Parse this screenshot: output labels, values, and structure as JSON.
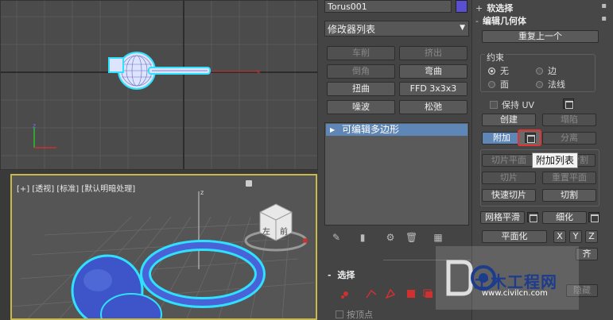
{
  "viewport_top": {
    "axis_x": "x",
    "axis_y": "y"
  },
  "viewport_persp": {
    "labels": [
      "[+]",
      "[透视]",
      "[标准]",
      "[默认明暗处理]"
    ],
    "viewcube_front": "前",
    "viewcube_left": "左",
    "axis_z": "z"
  },
  "command_panel": {
    "object_name": "Torus001",
    "object_color": "#5a4fd0",
    "modifier_list": "修改器列表",
    "modifier_buttons": [
      {
        "label": "车削",
        "enabled": false
      },
      {
        "label": "挤出",
        "enabled": false
      },
      {
        "label": "倒角",
        "enabled": false
      },
      {
        "label": "弯曲",
        "enabled": true
      },
      {
        "label": "扭曲",
        "enabled": true
      },
      {
        "label": "FFD 3x3x3",
        "enabled": true
      },
      {
        "label": "噪波",
        "enabled": true
      },
      {
        "label": "松弛",
        "enabled": true
      }
    ],
    "stack_item": "可编辑多边形",
    "selection_header": "选择",
    "selection_sign": "-",
    "by_vertex": "按顶点"
  },
  "right_panel": {
    "soft_selection": "软选择",
    "soft_sign": "+",
    "edit_geometry": "编辑几何体",
    "edit_sign": "-",
    "repeat_last": "重复上一个",
    "constraints_title": "约束",
    "radios": [
      {
        "label": "无",
        "selected": true
      },
      {
        "label": "边",
        "selected": false
      },
      {
        "label": "面",
        "selected": false
      },
      {
        "label": "法线",
        "selected": false
      }
    ],
    "preserve_uv": "保持 UV",
    "create": "创建",
    "collapse": "塌陷",
    "attach": "附加",
    "detach": "分离",
    "attach_list_tooltip": "附加列表",
    "slice_plane": "切片平面",
    "split": "分割",
    "slice": "切片",
    "reset_plane": "重置平面",
    "quickslice": "快速切片",
    "cut": "切割",
    "meshsmooth": "网格平滑",
    "tessellate": "细化",
    "make_planar": "平面化",
    "x": "X",
    "y": "Y",
    "z": "Z",
    "align": "齐",
    "hide": "隐藏",
    "accent": "#5e86b6"
  },
  "watermark": {
    "cn": "土木工程网",
    "url": "www.civilcn.com"
  }
}
